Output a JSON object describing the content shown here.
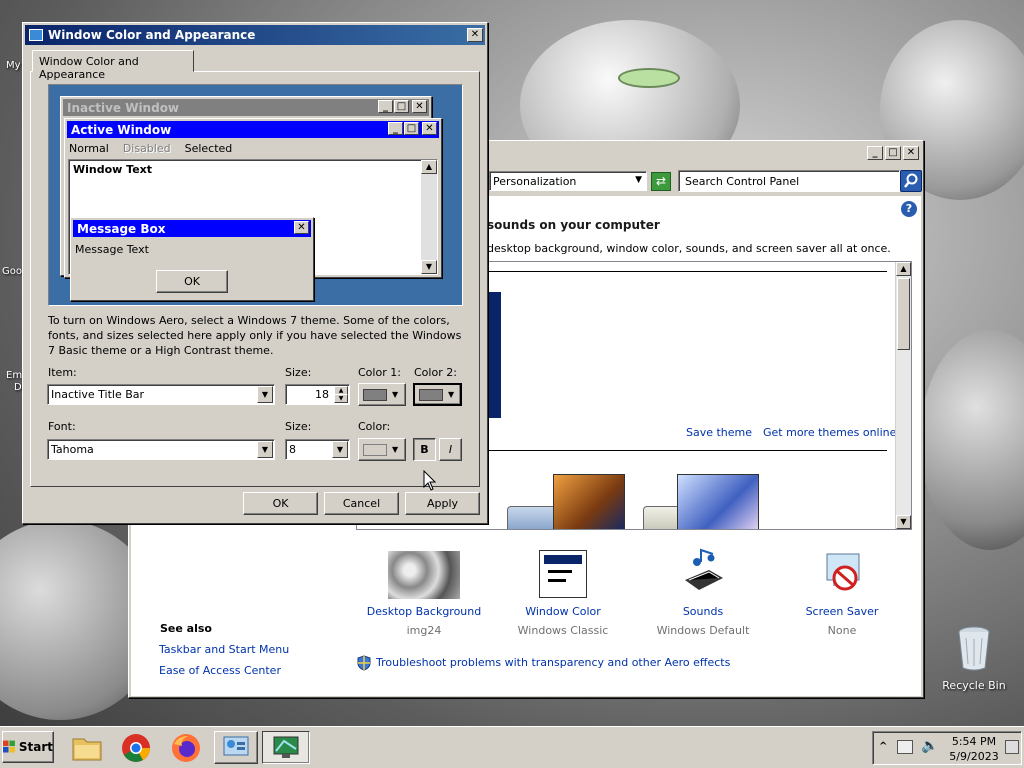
{
  "desktop": {
    "recycle_bin_label": "Recycle Bin",
    "edge_labels": [
      "My",
      "Goo",
      "Em",
      "D"
    ]
  },
  "appearance": {
    "title": "Window Color and Appearance",
    "tab_label": "Window Color and Appearance",
    "preview": {
      "inactive_title": "Inactive Window",
      "active_title": "Active Window",
      "menu_normal": "Normal",
      "menu_disabled": "Disabled",
      "menu_selected": "Selected",
      "window_text": "Window Text",
      "msgbox_title": "Message Box",
      "msgbox_text": "Message Text",
      "msgbox_ok": "OK"
    },
    "description": "To turn on Windows Aero, select a Windows 7 theme.  Some of the colors, fonts, and sizes selected here apply only if you have selected the Windows 7 Basic theme or a High Contrast theme.",
    "item_label": "Item:",
    "item_value": "Inactive Title Bar",
    "size_label": "Size:",
    "size_value": "18",
    "color1_label": "Color 1:",
    "color2_label": "Color 2:",
    "font_label": "Font:",
    "font_value": "Tahoma",
    "font_size_label": "Size:",
    "font_size_value": "8",
    "font_color_label": "Color:",
    "bold_label": "B",
    "italic_label": "I",
    "ok_label": "OK",
    "cancel_label": "Cancel",
    "apply_label": "Apply",
    "colors": {
      "active_title": "#0000ff",
      "inactive_title": "#808080",
      "selected_menu": "#0000ff"
    }
  },
  "personalization": {
    "address_value": "Personalization",
    "search_placeholder": "Search Control Panel",
    "heading": "sounds on your computer",
    "subheading": "desktop background, window color, sounds, and screen saver all at once.",
    "save_theme": "Save theme",
    "get_more_themes": "Get more themes online",
    "items": [
      {
        "title": "Desktop Background",
        "sub": "img24"
      },
      {
        "title": "Window Color",
        "sub": "Windows Classic"
      },
      {
        "title": "Sounds",
        "sub": "Windows Default"
      },
      {
        "title": "Screen Saver",
        "sub": "None"
      }
    ],
    "see_also_title": "See also",
    "see_also_links": [
      "Taskbar and Start Menu",
      "Ease of Access Center"
    ],
    "troubleshoot": "Troubleshoot problems with transparency and other Aero effects"
  },
  "taskbar": {
    "start_label": "Start",
    "time": "5:54 PM",
    "date": "5/9/2023"
  }
}
